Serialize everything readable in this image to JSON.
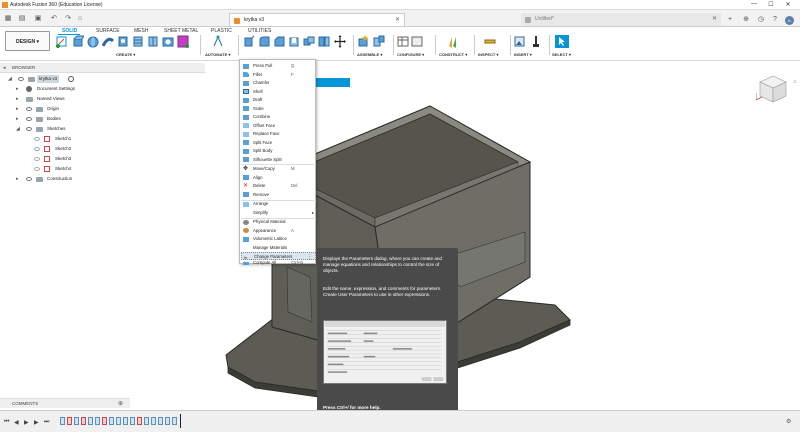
{
  "window": {
    "title": "Autodesk Fusion 360 (Education License)",
    "minimize": "—",
    "maximize": "☐",
    "close": "✕"
  },
  "tabs": {
    "active": "krytka v3",
    "inactive": "Untitled*"
  },
  "workspace": {
    "design_label": "DESIGN",
    "tabs": [
      "SOLID",
      "SURFACE",
      "MESH",
      "SHEET METAL",
      "PLASTIC",
      "UTILITIES"
    ],
    "active_tab": "SOLID"
  },
  "toolbar_groups": [
    {
      "label": "CREATE ▾"
    },
    {
      "label": "AUTOMATE ▾"
    },
    {
      "label": "MODIFY ▾"
    },
    {
      "label": "ASSEMBLE ▾"
    },
    {
      "label": "CONFIGURE ▾"
    },
    {
      "label": "CONSTRUCT ▾"
    },
    {
      "label": "INSPECT ▾"
    },
    {
      "label": "INSERT ▾"
    },
    {
      "label": "SELECT ▾"
    }
  ],
  "browser": {
    "header": "BROWSER",
    "items": [
      {
        "label": "krytka v3"
      },
      {
        "label": "Document Settings"
      },
      {
        "label": "Named Views"
      },
      {
        "label": "Origin"
      },
      {
        "label": "Bodies"
      },
      {
        "label": "Sketches"
      },
      {
        "label": "Sketch1"
      },
      {
        "label": "Sketch2"
      },
      {
        "label": "Sketch3"
      },
      {
        "label": "Sketch4"
      },
      {
        "label": "Construction"
      }
    ]
  },
  "modify_menu": {
    "items": [
      {
        "label": "Press Pull",
        "key": "Q"
      },
      {
        "label": "Fillet",
        "key": "F"
      },
      {
        "label": "Chamfer",
        "key": ""
      },
      {
        "label": "Shell",
        "key": ""
      },
      {
        "label": "Draft",
        "key": ""
      },
      {
        "label": "Scale",
        "key": ""
      },
      {
        "label": "Combine",
        "key": ""
      },
      {
        "label": "Offset Face",
        "key": ""
      },
      {
        "label": "Replace Face",
        "key": ""
      },
      {
        "label": "Split Face",
        "key": ""
      },
      {
        "label": "Split Body",
        "key": ""
      },
      {
        "label": "Silhouette Split",
        "key": ""
      },
      {
        "label": "Move/Copy",
        "key": "M"
      },
      {
        "label": "Align",
        "key": ""
      },
      {
        "label": "Delete",
        "key": "Del"
      },
      {
        "label": "Remove",
        "key": ""
      },
      {
        "label": "Arrange",
        "key": ""
      },
      {
        "label": "Simplify",
        "key": ""
      },
      {
        "label": "Physical Material",
        "key": ""
      },
      {
        "label": "Appearance",
        "key": "A"
      },
      {
        "label": "Volumetric Lattice",
        "key": ""
      },
      {
        "label": "Manage Materials",
        "key": ""
      },
      {
        "label": "Change Parameters",
        "key": ""
      },
      {
        "label": "Compute All",
        "key": "Ctrl+B"
      }
    ]
  },
  "tooltip": {
    "p1": "Displays the Parameters dialog, where you can create and manage equations and relationships to control the size of objects.",
    "p2": "Edit the name, expression, and comments for parameters. Create User Parameters to use in other expressions.",
    "p3": "Press Ctrl+/ for more help."
  },
  "comments": {
    "label": "COMMENTS"
  },
  "colors": {
    "accent": "#0696d7",
    "model": "#5f5f58",
    "tooltip_bg": "#4a4a4a"
  }
}
